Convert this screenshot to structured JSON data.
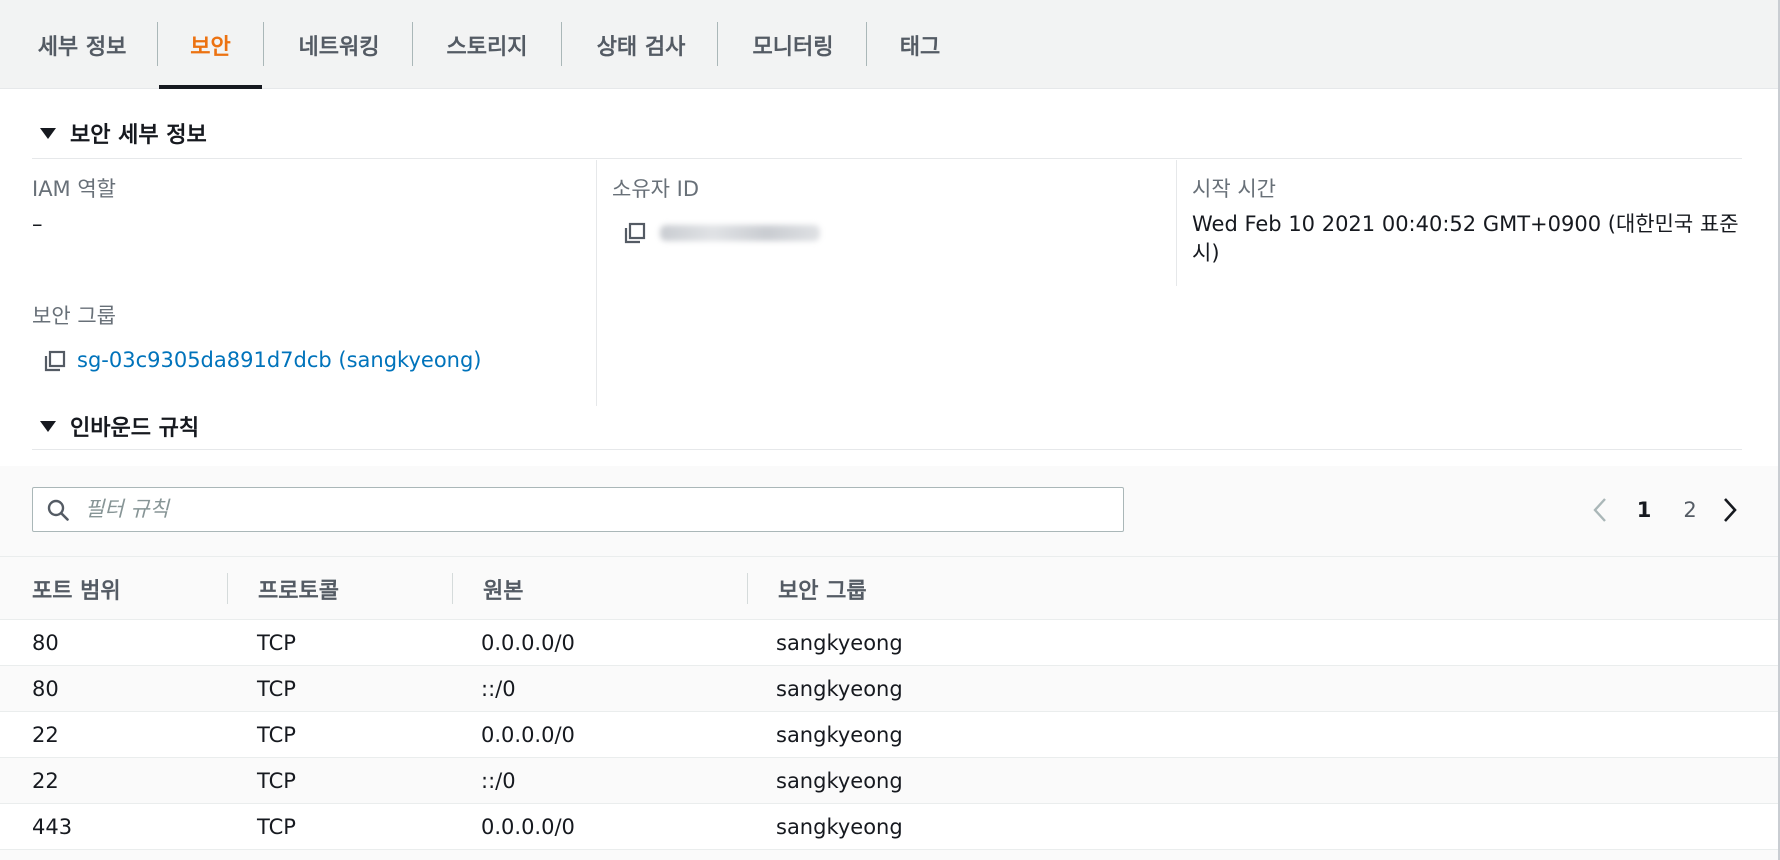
{
  "tabs": [
    {
      "label": "세부 정보",
      "active": false
    },
    {
      "label": "보안",
      "active": true
    },
    {
      "label": "네트워킹",
      "active": false
    },
    {
      "label": "스토리지",
      "active": false
    },
    {
      "label": "상태 검사",
      "active": false
    },
    {
      "label": "모니터링",
      "active": false
    },
    {
      "label": "태그",
      "active": false
    }
  ],
  "security_details": {
    "header": "보안 세부 정보",
    "iam_role_label": "IAM 역할",
    "iam_role_value": "–",
    "owner_id_label": "소유자 ID",
    "owner_id_value": "",
    "start_time_label": "시작 시간",
    "start_time_value": "Wed Feb 10 2021 00:40:52 GMT+0900 (대한민국 표준시)",
    "security_group_label": "보안 그룹",
    "security_group_link": "sg-03c9305da891d7dcb (sangkyeong)"
  },
  "inbound_rules": {
    "header": "인바운드 규칙",
    "filter_placeholder": "필터 규칙",
    "pagination": {
      "current": "1",
      "next": "2"
    },
    "columns": [
      "포트 범위",
      "프로토콜",
      "원본",
      "보안 그룹"
    ],
    "rows": [
      {
        "port": "80",
        "protocol": "TCP",
        "source": "0.0.0.0/0",
        "group": "sangkyeong"
      },
      {
        "port": "80",
        "protocol": "TCP",
        "source": "::/0",
        "group": "sangkyeong"
      },
      {
        "port": "22",
        "protocol": "TCP",
        "source": "0.0.0.0/0",
        "group": "sangkyeong"
      },
      {
        "port": "22",
        "protocol": "TCP",
        "source": "::/0",
        "group": "sangkyeong"
      },
      {
        "port": "443",
        "protocol": "TCP",
        "source": "0.0.0.0/0",
        "group": "sangkyeong"
      }
    ]
  },
  "icons": {
    "copy": "copy-icon",
    "search": "search-icon",
    "collapse": "caret-down-icon",
    "prev": "chevron-left-icon",
    "next": "chevron-right-icon"
  },
  "colors": {
    "accent": "#ec7211",
    "link": "#0073bb",
    "text": "#16191f"
  }
}
